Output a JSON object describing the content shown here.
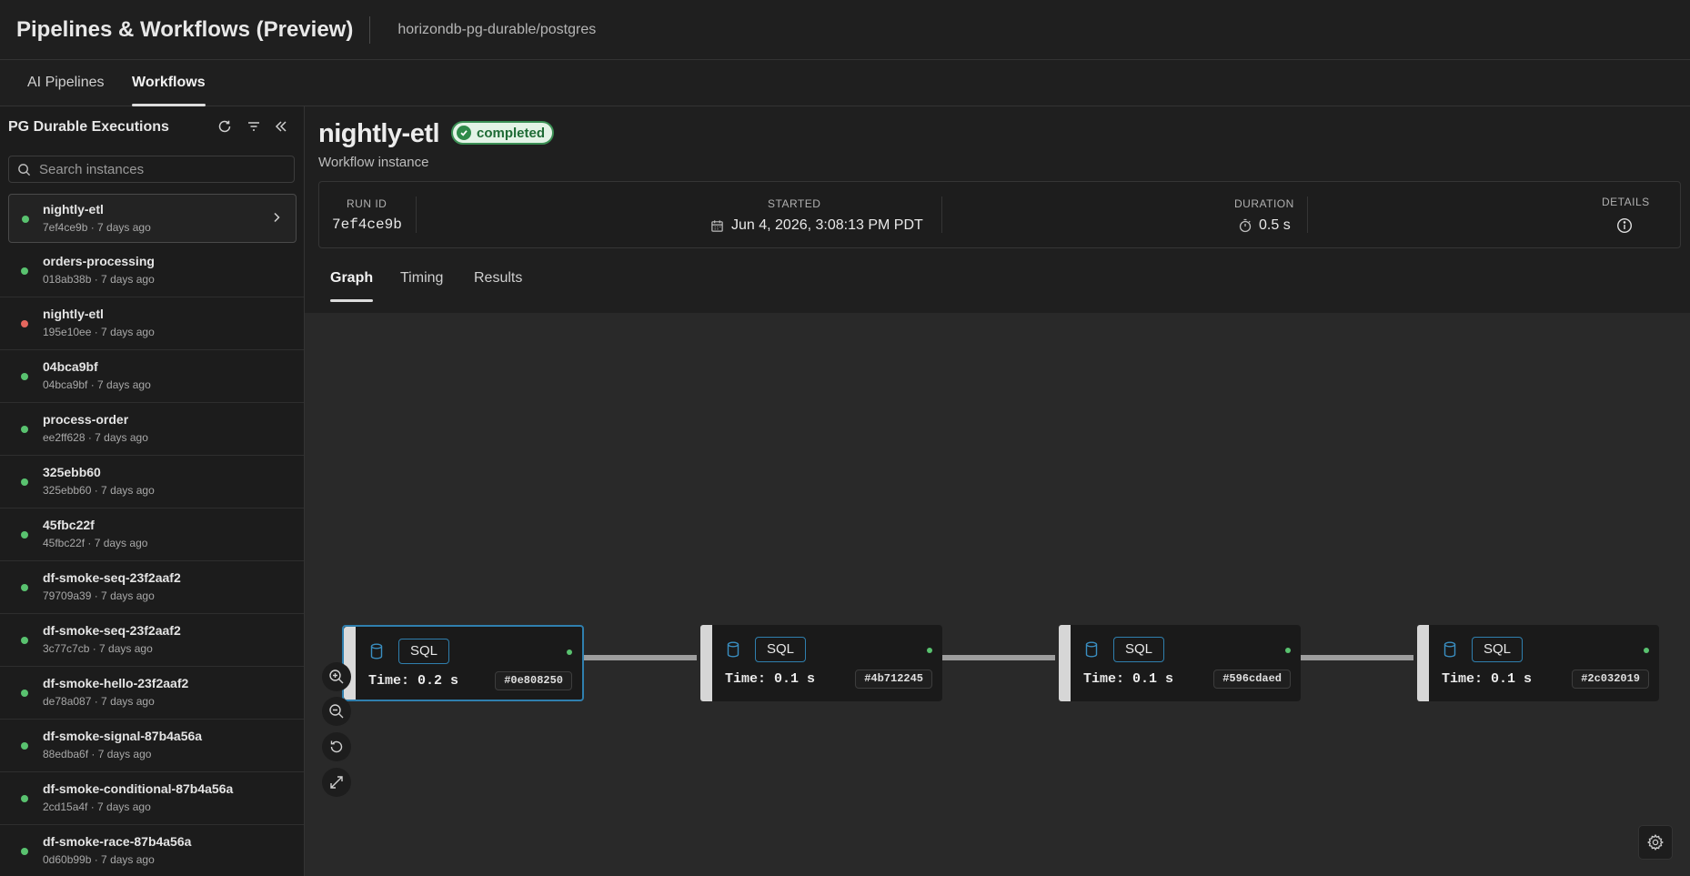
{
  "header": {
    "title": "Pipelines & Workflows (Preview)",
    "breadcrumb": "horizondb-pg-durable/postgres"
  },
  "top_tabs": [
    {
      "label": "AI Pipelines",
      "active": false
    },
    {
      "label": "Workflows",
      "active": true
    }
  ],
  "sidebar": {
    "title": "PG Durable Executions",
    "refresh_icon": "refresh-icon",
    "filter_icon": "filter-icon",
    "collapse_icon": "collapse-left-icon",
    "search_placeholder": "Search instances",
    "instances": [
      {
        "name": "nightly-etl",
        "meta": "7ef4ce9b · 7 days ago",
        "status": "completed",
        "selected": true
      },
      {
        "name": "orders-processing",
        "meta": "018ab38b · 7 days ago",
        "status": "completed"
      },
      {
        "name": "nightly-etl",
        "meta": "195e10ee · 7 days ago",
        "status": "failed"
      },
      {
        "name": "04bca9bf",
        "meta": "04bca9bf · 7 days ago",
        "status": "completed"
      },
      {
        "name": "process-order",
        "meta": "ee2ff628 · 7 days ago",
        "status": "completed"
      },
      {
        "name": "325ebb60",
        "meta": "325ebb60 · 7 days ago",
        "status": "completed"
      },
      {
        "name": "45fbc22f",
        "meta": "45fbc22f · 7 days ago",
        "status": "completed"
      },
      {
        "name": "df-smoke-seq-23f2aaf2",
        "meta": "79709a39 · 7 days ago",
        "status": "completed"
      },
      {
        "name": "df-smoke-seq-23f2aaf2",
        "meta": "3c77c7cb · 7 days ago",
        "status": "completed"
      },
      {
        "name": "df-smoke-hello-23f2aaf2",
        "meta": "de78a087 · 7 days ago",
        "status": "completed"
      },
      {
        "name": "df-smoke-signal-87b4a56a",
        "meta": "88edba6f · 7 days ago",
        "status": "completed"
      },
      {
        "name": "df-smoke-conditional-87b4a56a",
        "meta": "2cd15a4f · 7 days ago",
        "status": "completed"
      },
      {
        "name": "df-smoke-race-87b4a56a",
        "meta": "0d60b99b · 7 days ago",
        "status": "completed"
      }
    ]
  },
  "workflow": {
    "name": "nightly-etl",
    "status": "completed",
    "subtitle": "Workflow instance",
    "run_id_label": "RUN ID",
    "run_id": "7ef4ce9b",
    "started_label": "STARTED",
    "started": "Jun 4, 2026, 3:08:13 PM PDT",
    "duration_label": "DURATION",
    "duration": "0.5 s",
    "details_label": "DETAILS"
  },
  "sub_tabs": [
    {
      "label": "Graph",
      "active": true
    },
    {
      "label": "Timing",
      "active": false
    },
    {
      "label": "Results",
      "active": false
    }
  ],
  "graph": {
    "nodes": [
      {
        "type": "SQL",
        "time": "Time: 0.2 s",
        "id": "#0e808250",
        "selected": true
      },
      {
        "type": "SQL",
        "time": "Time: 0.1 s",
        "id": "#4b712245",
        "selected": false
      },
      {
        "type": "SQL",
        "time": "Time: 0.1 s",
        "id": "#596cdaed",
        "selected": false
      },
      {
        "type": "SQL",
        "time": "Time: 0.1 s",
        "id": "#2c032019",
        "selected": false
      }
    ],
    "controls": [
      "zoom-in-icon",
      "zoom-out-icon",
      "reset-icon",
      "fit-view-icon"
    ]
  },
  "colors": {
    "success": "#59c26f",
    "error": "#e5675e",
    "accent": "#2f7fae"
  }
}
